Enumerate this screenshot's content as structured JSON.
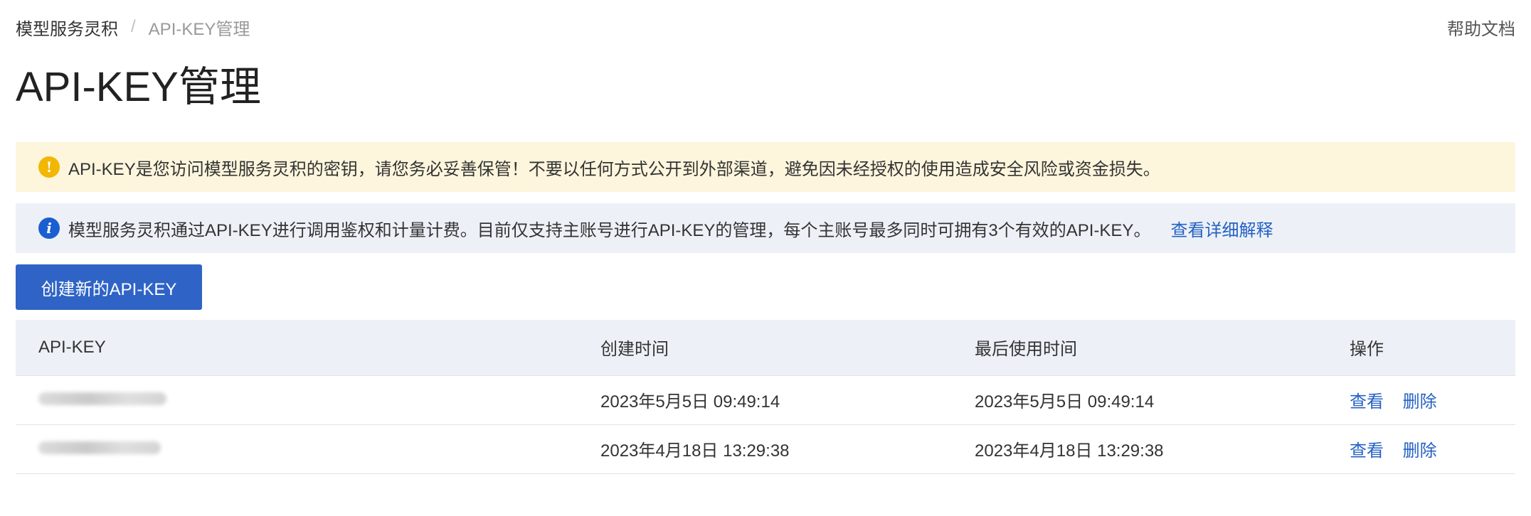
{
  "breadcrumb": {
    "root": "模型服务灵积",
    "separator": "/",
    "current": "API-KEY管理"
  },
  "help": {
    "label": "帮助文档"
  },
  "page": {
    "title": "API-KEY管理"
  },
  "alerts": {
    "warning": {
      "icon": "warning-icon",
      "text": "API-KEY是您访问模型服务灵积的密钥，请您务必妥善保管！不要以任何方式公开到外部渠道，避免因未经授权的使用造成安全风险或资金损失。"
    },
    "info": {
      "icon": "info-icon",
      "text": "模型服务灵积通过API-KEY进行调用鉴权和计量计费。目前仅支持主账号进行API-KEY的管理，每个主账号最多同时可拥有3个有效的API-KEY。",
      "link": "查看详细解释"
    }
  },
  "create_button": {
    "label": "创建新的API-KEY"
  },
  "table": {
    "columns": [
      "API-KEY",
      "创建时间",
      "最后使用时间",
      "操作"
    ],
    "rows": [
      {
        "created": "2023年5月5日 09:49:14",
        "last_used": "2023年5月5日 09:49:14",
        "view": "查看",
        "delete": "删除"
      },
      {
        "created": "2023年4月18日 13:29:38",
        "last_used": "2023年4月18日 13:29:38",
        "view": "查看",
        "delete": "删除"
      }
    ]
  },
  "colors": {
    "primary": "#2f64c6",
    "link": "#2461c4",
    "warning_bg": "#fdf6dd",
    "info_bg": "#edf1f7"
  }
}
